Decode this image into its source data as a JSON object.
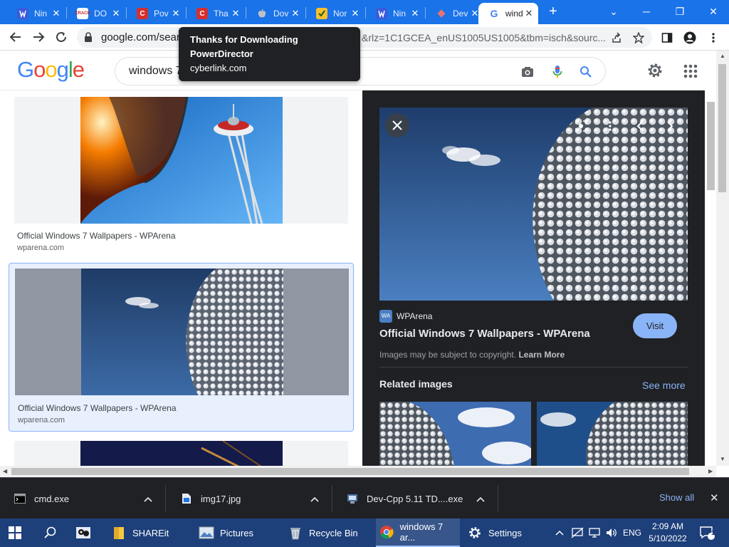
{
  "browser": {
    "tabs": [
      {
        "title": "Nin",
        "favicon": "wordpress-icon",
        "color": "#3b5bdb"
      },
      {
        "title": "DO",
        "favicon": "crack-icon",
        "color": "#c62828"
      },
      {
        "title": "Pov",
        "favicon": "cyberlink-icon",
        "color": "#d32f2f"
      },
      {
        "title": "Tha",
        "favicon": "cyberlink-icon",
        "color": "#d32f2f"
      },
      {
        "title": "Dov",
        "favicon": "apple-icon",
        "color": "#9aa0a6"
      },
      {
        "title": "Nor",
        "favicon": "checkbox-icon",
        "color": "#fbc02d"
      },
      {
        "title": "Nin",
        "favicon": "wordpress-icon",
        "color": "#3b5bdb"
      },
      {
        "title": "Dev",
        "favicon": "diamond-icon",
        "color": "#e57373"
      },
      {
        "title": "wind",
        "favicon": "google-icon",
        "color": "#ffffff"
      }
    ],
    "tab_close": "✕",
    "new_tab": "+",
    "window_controls": {
      "minimize": "─",
      "maximize": "❐",
      "close": "✕",
      "dropdown": "⌄"
    },
    "url_host": "google.com/searc",
    "url_tail": "&rlz=1C1GCEA_enUS1005US1005&tbm=isch&sourc...",
    "tooltip": {
      "title_line1": "Thanks for Downloading",
      "title_line2": "PowerDirector",
      "domain": "cyberlink.com"
    }
  },
  "google": {
    "logo": [
      "G",
      "o",
      "o",
      "g",
      "l",
      "e"
    ],
    "logo_colors": [
      "#4285f4",
      "#ea4335",
      "#fbbc05",
      "#4285f4",
      "#34a853",
      "#ea4335"
    ],
    "query": "windows 7"
  },
  "results": [
    {
      "title": "Official Windows 7 Wallpapers - WPArena",
      "source": "wparena.com"
    },
    {
      "title": "Official Windows 7 Wallpapers - WPArena",
      "source": "wparena.com"
    }
  ],
  "preview": {
    "source_name": "WPArena",
    "source_logo": "WA",
    "title": "Official Windows 7 Wallpapers - WPArena",
    "visit_label": "Visit",
    "copyright_text": "Images may be subject to copyright.",
    "learn_more": "Learn More",
    "related_heading": "Related images",
    "see_more": "See more"
  },
  "downloads": {
    "items": [
      {
        "name": "cmd.exe",
        "icon": "cmd-icon"
      },
      {
        "name": "img17.jpg",
        "icon": "image-file-icon"
      },
      {
        "name": "Dev-Cpp 5.11 TD....exe",
        "icon": "installer-icon"
      }
    ],
    "chevron": "^",
    "show_all": "Show all",
    "close": "✕"
  },
  "taskbar": {
    "apps": [
      {
        "label": "",
        "icon": "app-icon"
      },
      {
        "label": "SHAREit",
        "icon": "folder-icon"
      },
      {
        "label": "Pictures",
        "icon": "pictures-icon"
      },
      {
        "label": "Recycle Bin",
        "icon": "recycle-bin-icon"
      },
      {
        "label": "windows 7 ar...",
        "icon": "chrome-icon"
      },
      {
        "label": "Settings",
        "icon": "gear-icon"
      }
    ],
    "language": "ENG",
    "time": "2:09 AM",
    "date": "5/10/2022",
    "notification_count": "1"
  }
}
